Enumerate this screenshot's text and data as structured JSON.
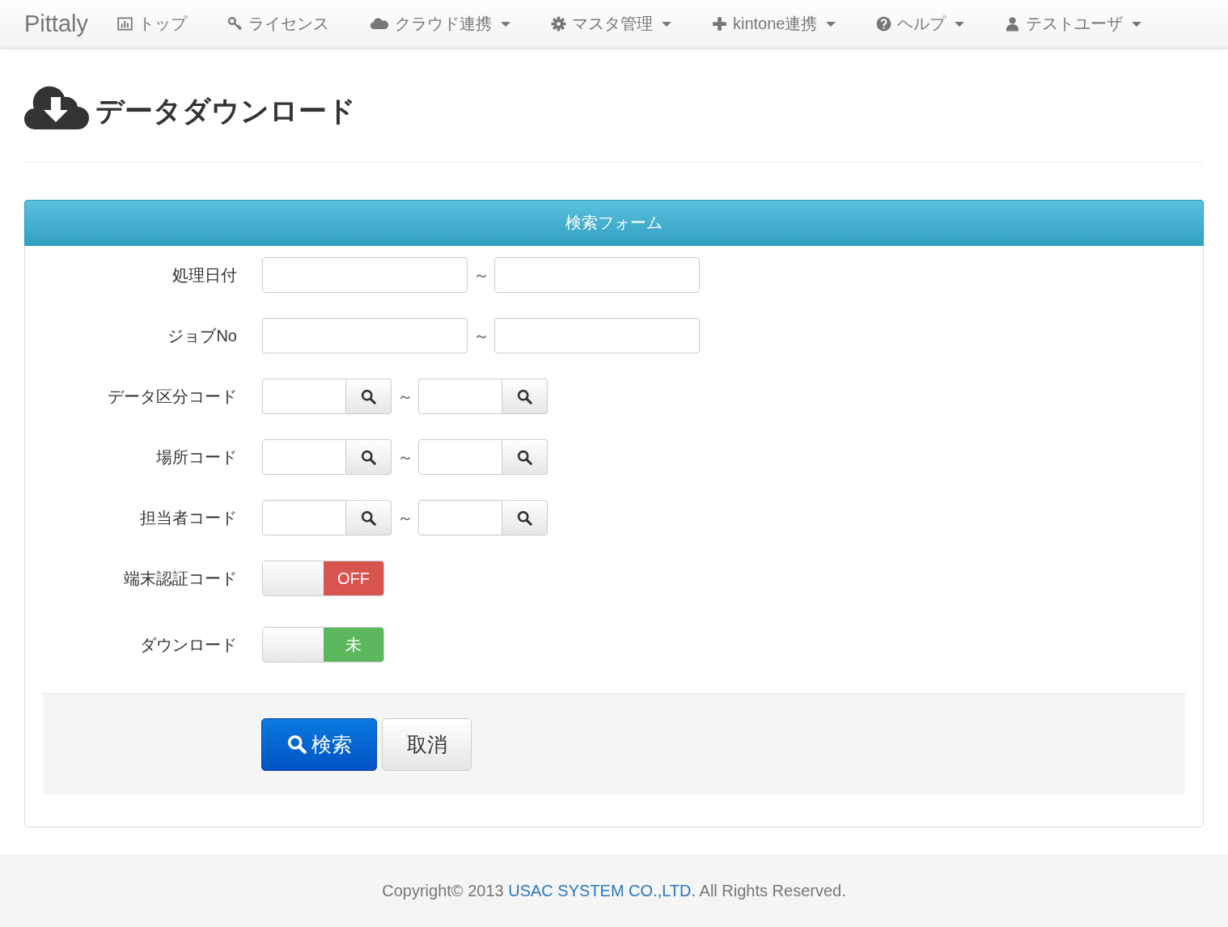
{
  "navbar": {
    "brand": "Pittaly",
    "items": [
      {
        "label": "トップ",
        "dropdown": false
      },
      {
        "label": "ライセンス",
        "dropdown": false
      },
      {
        "label": "クラウド連携",
        "dropdown": true
      },
      {
        "label": "マスタ管理",
        "dropdown": true
      },
      {
        "label": "kintone連携",
        "dropdown": true
      },
      {
        "label": "ヘルプ",
        "dropdown": true
      },
      {
        "label": "テストユーザ",
        "dropdown": true
      }
    ]
  },
  "page_title": "データダウンロード",
  "search_panel": {
    "heading": "検索フォーム",
    "fields": [
      {
        "kind": "range",
        "label": "処理日付",
        "separator": "～"
      },
      {
        "kind": "range",
        "label": "ジョブNo",
        "separator": "～"
      },
      {
        "kind": "lookup",
        "label": "データ区分コード",
        "separator": "～"
      },
      {
        "kind": "lookup",
        "label": "場所コード",
        "separator": "～"
      },
      {
        "kind": "lookup",
        "label": "担当者コード",
        "separator": "～"
      },
      {
        "kind": "toggle",
        "label": "端末認証コード",
        "on": false,
        "state_text": "OFF",
        "color": "#d9534f"
      },
      {
        "kind": "toggle",
        "label": "ダウンロード",
        "on": false,
        "state_text": "未",
        "color": "#5cb85c"
      }
    ],
    "buttons": [
      {
        "kind": "primary",
        "label": "検索"
      },
      {
        "kind": "default",
        "label": "取消"
      }
    ]
  },
  "footer": {
    "prefix": "Copyright© 2013",
    "link": "USAC SYSTEM CO.,LTD.",
    "suffix": "All Rights Reserved."
  }
}
